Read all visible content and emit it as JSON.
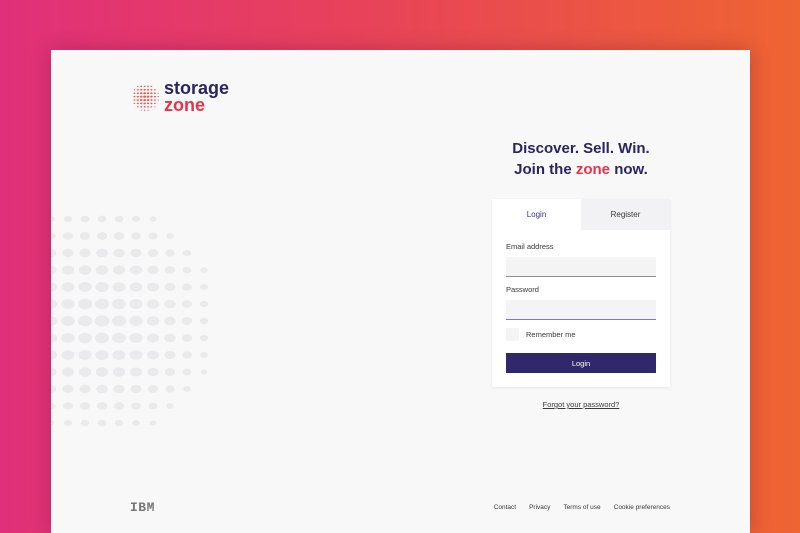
{
  "brand": {
    "line1": "storage",
    "line2": "zone",
    "colors": {
      "navy": "#2b2460",
      "accent": "#e6334c",
      "button": "#30286a"
    }
  },
  "headline": {
    "line1": "Discover. Sell. Win.",
    "line2_prefix": "Join the",
    "line2_accent": "zone",
    "line2_suffix": "now."
  },
  "tabs": [
    {
      "label": "Login",
      "active": true
    },
    {
      "label": "Register",
      "active": false
    }
  ],
  "form": {
    "email_label": "Email address",
    "email_value": "",
    "password_label": "Password",
    "password_value": "",
    "remember_label": "Remember me",
    "remember_checked": false,
    "submit_label": "Login"
  },
  "forgot_link": "Forgot your password?",
  "footer": {
    "company_logo": "IBM",
    "links": [
      "Contact",
      "Privacy",
      "Terms of use",
      "Cookie preferences"
    ]
  },
  "icons": [
    "storagezone-globe-logo-icon",
    "decorative-dot-globe-icon",
    "ibm-logo-icon"
  ]
}
